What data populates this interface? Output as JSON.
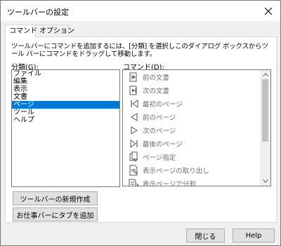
{
  "window": {
    "title": "ツールバーの設定"
  },
  "tabs": [
    {
      "label": "コマンド",
      "active": true
    },
    {
      "label": "オプション",
      "active": false
    }
  ],
  "description": {
    "line1": "ツールバーにコマンドを追加するには、[分類] を選択しこのダイアログ ボックスからツ",
    "line2": "ール バーにコマンドをドラッグして移動します。"
  },
  "categories": {
    "label": "分類(G):",
    "items": [
      "ファイル",
      "編集",
      "表示",
      "文書",
      "ページ",
      "ツール",
      "ヘルプ"
    ],
    "selected_index": 4
  },
  "commands": {
    "label": "コマンド(D):",
    "items": [
      {
        "label": "前の文書",
        "icon": "prev-document-icon"
      },
      {
        "label": "次の文書",
        "icon": "next-document-icon"
      },
      {
        "label": "最初のページ",
        "icon": "first-page-icon"
      },
      {
        "label": "前のページ",
        "icon": "previous-page-icon"
      },
      {
        "label": "次のページ",
        "icon": "next-page-icon"
      },
      {
        "label": "最後のページ",
        "icon": "last-page-icon"
      },
      {
        "label": "ページ指定",
        "icon": "go-to-page-icon"
      },
      {
        "label": "表示ページの取り出し",
        "icon": "extract-page-icon"
      },
      {
        "label": "表示ページで分割",
        "icon": "split-page-icon"
      }
    ]
  },
  "buttons": {
    "new_toolbar": "ツールバーの新規作成",
    "add_to_work_bar": "お仕事バーにタブを追加",
    "close": "閉じる",
    "help": "Help"
  },
  "colors": {
    "selection": "#0078d7",
    "disabled_text": "#6d6d6d"
  }
}
